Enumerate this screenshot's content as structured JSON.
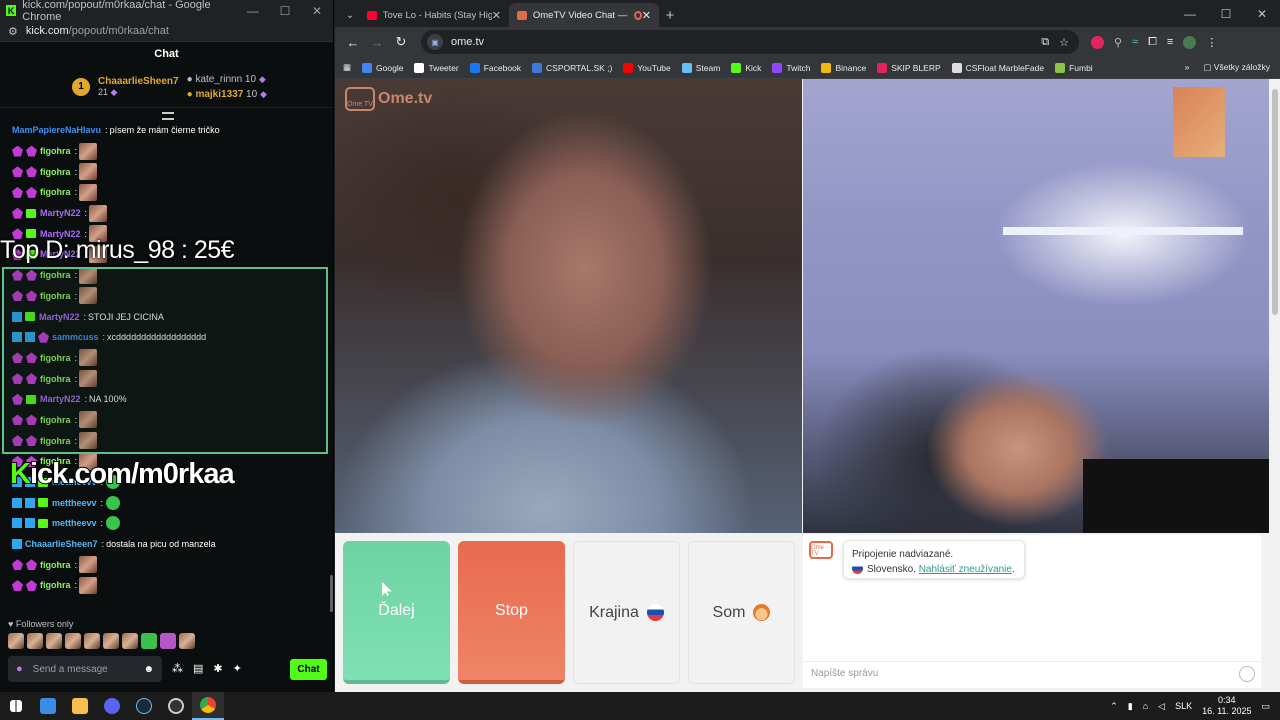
{
  "left_window": {
    "title": "kick.com/popout/m0rkaa/chat - Google Chrome",
    "url_host": "kick.com",
    "url_path": "/popout/m0rkaa/chat",
    "chat_title": "Chat",
    "leaderboard": {
      "first": {
        "rank": "1",
        "name": "ChaaarlieSheen7",
        "count": "21"
      },
      "second": {
        "name": "kate_rinnn",
        "count": "10"
      },
      "third": {
        "name": "majki1337",
        "count": "10"
      }
    },
    "messages": [
      {
        "user": "MamPapiereNaHlavu",
        "color": "cblue",
        "text": "písem že mám čierne tričko",
        "badges": "none",
        "emote": false
      },
      {
        "user": "figohra",
        "color": "cgreen",
        "text": "",
        "badges": "pp",
        "emote": true
      },
      {
        "user": "figohra",
        "color": "cgreen",
        "text": "",
        "badges": "pp",
        "emote": true
      },
      {
        "user": "figohra",
        "color": "cgreen",
        "text": "",
        "badges": "pp",
        "emote": true
      },
      {
        "user": "MartyN22",
        "color": "cviolet",
        "text": "",
        "badges": "pg",
        "emote": true
      },
      {
        "user": "MartyN22",
        "color": "cviolet",
        "text": "",
        "badges": "pg",
        "emote": true
      },
      {
        "user": "MartyN22",
        "color": "cviolet",
        "text": "",
        "badges": "pg",
        "emote": true
      },
      {
        "user": "figohra",
        "color": "cgreen",
        "text": "",
        "badges": "pp",
        "emote": true
      },
      {
        "user": "figohra",
        "color": "cgreen",
        "text": "",
        "badges": "pp",
        "emote": true
      },
      {
        "user": "MartyN22",
        "color": "cviolet",
        "text": "STOJI JEJ CICINA",
        "badges": "bg",
        "emote": false
      },
      {
        "user": "sammcuss",
        "color": "cblue",
        "text": "xcdddddddddddddddddd",
        "badges": "bbp",
        "emote": false
      },
      {
        "user": "figohra",
        "color": "cgreen",
        "text": "",
        "badges": "pp",
        "emote": true
      },
      {
        "user": "figohra",
        "color": "cgreen",
        "text": "",
        "badges": "pp",
        "emote": true
      },
      {
        "user": "MartyN22",
        "color": "cviolet",
        "text": "NA 100%",
        "badges": "pg",
        "emote": false
      },
      {
        "user": "figohra",
        "color": "cgreen",
        "text": "",
        "badges": "pp",
        "emote": true
      },
      {
        "user": "figohra",
        "color": "cgreen",
        "text": "",
        "badges": "pp",
        "emote": true
      },
      {
        "user": "figohra",
        "color": "cgreen",
        "text": "",
        "badges": "pp",
        "emote": true
      },
      {
        "user": "mettheevv",
        "color": "ccyan",
        "text": "",
        "badges": "bbg",
        "emote": false,
        "pepe": true
      },
      {
        "user": "mettheevv",
        "color": "ccyan",
        "text": "",
        "badges": "bbg",
        "emote": false,
        "pepe": true
      },
      {
        "user": "mettheevv",
        "color": "ccyan",
        "text": "",
        "badges": "bbg",
        "emote": false,
        "pepe": true
      },
      {
        "user": "ChaaarlieSheen7",
        "color": "ccyan",
        "text": "dostala na picu od manzela",
        "badges": "b",
        "emote": false
      },
      {
        "user": "figohra",
        "color": "cgreen",
        "text": "",
        "badges": "pp",
        "emote": true
      },
      {
        "user": "figohra",
        "color": "cgreen",
        "text": "",
        "badges": "pp",
        "emote": true
      }
    ],
    "overlay_top": "Top D: mirus_98 : 25€",
    "overlay_kick_k": "K",
    "overlay_kick_rest": "ick.com/m0rkaa",
    "followers_only": "Followers only",
    "send_placeholder": "Send a message",
    "chat_button": "Chat"
  },
  "tabs": [
    {
      "label": "Tove Lo - Habits (Stay High) - H",
      "color": "#ff0033",
      "active": false
    },
    {
      "label": "OmeTV Video Chat — Ome",
      "color": "#e56a4d",
      "active": true
    }
  ],
  "address": "ome.tv",
  "bookmarks": [
    {
      "label": "Google",
      "color": "#4285f4"
    },
    {
      "label": "Tweeter",
      "color": "#ffffff"
    },
    {
      "label": "Facebook",
      "color": "#1877f2"
    },
    {
      "label": "CSPORTAL.SK ;)",
      "color": "#3a7bd5"
    },
    {
      "label": "YouTube",
      "color": "#ff0000"
    },
    {
      "label": "Steam",
      "color": "#66c0f4"
    },
    {
      "label": "Kick",
      "color": "#53fc18"
    },
    {
      "label": "Twitch",
      "color": "#9146ff"
    },
    {
      "label": "Binance",
      "color": "#f0b90b"
    },
    {
      "label": "SKIP BLERP",
      "color": "#e0245e"
    },
    {
      "label": "CSFloat MarbleFade",
      "color": "#dddddd"
    },
    {
      "label": "Fumbi",
      "color": "#8bc34a"
    }
  ],
  "bookmarks_other": "Všetky záložky",
  "ome": {
    "logo_text": "Ome.tv",
    "logo_small": "Ome TV",
    "buttons": {
      "next": "Ďalej",
      "stop": "Stop",
      "country": "Krajina",
      "me": "Som"
    },
    "status_line": "Pripojenie nadviazané.",
    "country_line": "Slovensko.",
    "report_link": "Nahlásiť zneužívanie",
    "input_placeholder": "Napíšte správu"
  },
  "taskbar": {
    "lang": "SLK",
    "time": "0:34",
    "date": "16. 11. 2025"
  }
}
